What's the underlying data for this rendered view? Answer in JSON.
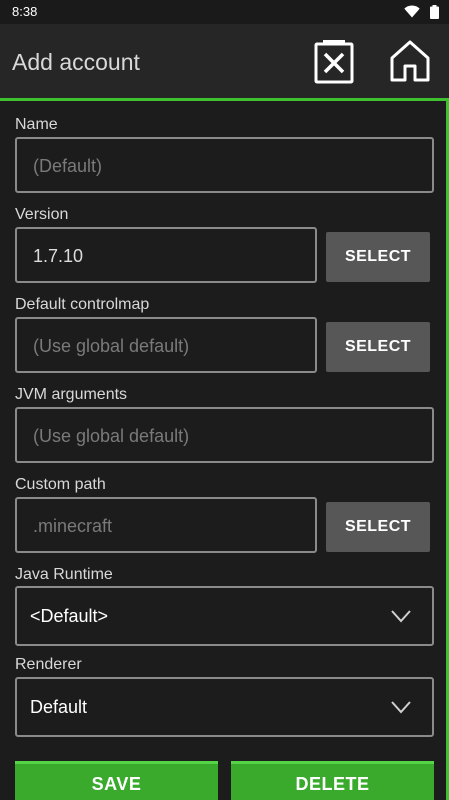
{
  "status_bar": {
    "time": "8:38",
    "icons": [
      "wifi-icon",
      "battery-icon"
    ]
  },
  "app_bar": {
    "title": "Add account",
    "actions": [
      "delete-x-icon",
      "home-icon"
    ]
  },
  "colors": {
    "accent": "#3fc130",
    "button_green": "#3aaa2d",
    "background": "#1c1c1c",
    "select_button": "#575757"
  },
  "form": {
    "name": {
      "label": "Name",
      "placeholder": "(Default)"
    },
    "version": {
      "label": "Version",
      "value": "1.7.10",
      "button": "SELECT"
    },
    "controlmap": {
      "label": "Default controlmap",
      "placeholder": "(Use global default)",
      "button": "SELECT"
    },
    "jvm_args": {
      "label": "JVM arguments",
      "placeholder": "(Use global default)"
    },
    "custom_path": {
      "label": "Custom path",
      "placeholder": ".minecraft",
      "button": "SELECT"
    },
    "java_runtime": {
      "label": "Java Runtime",
      "value": "<Default>"
    },
    "renderer": {
      "label": "Renderer",
      "value": "Default"
    }
  },
  "actions": {
    "save": "SAVE",
    "delete": "DELETE"
  }
}
